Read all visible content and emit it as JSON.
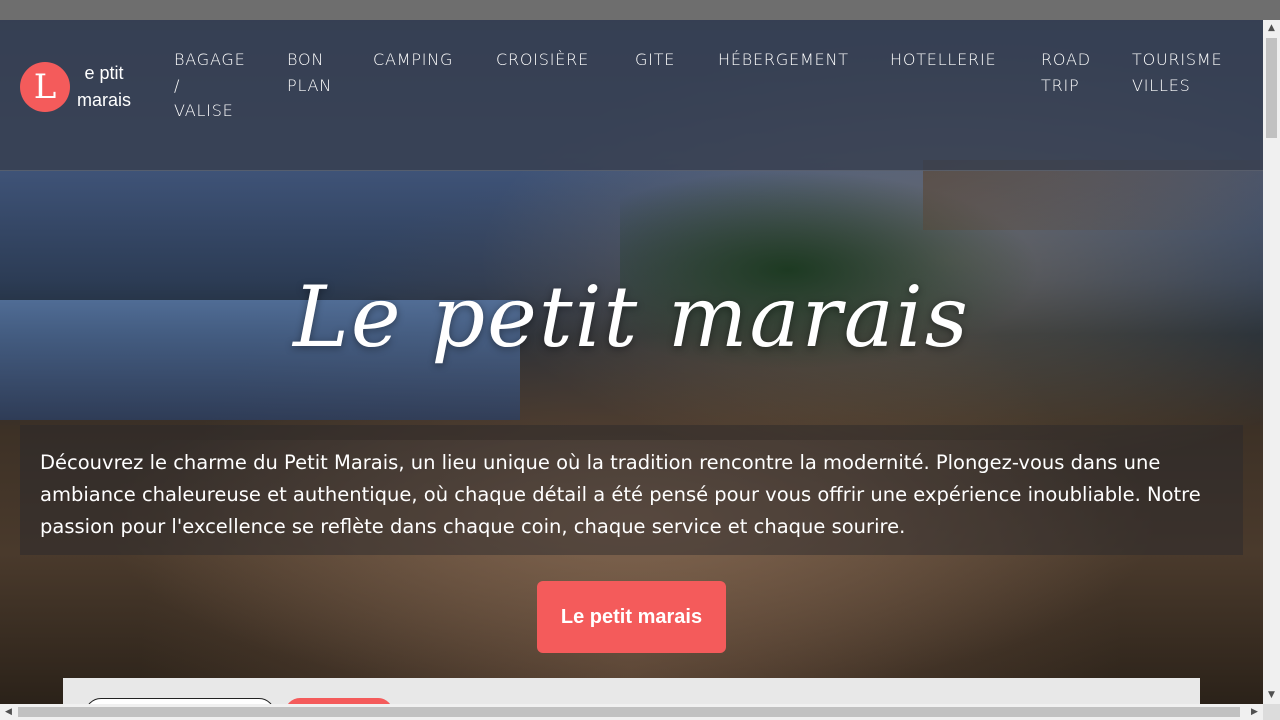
{
  "brand": {
    "logo_letter": "L",
    "name_line1": "e ptit",
    "name_line2": "marais",
    "accent_color": "#f45b5b"
  },
  "nav": {
    "items": [
      {
        "lines": [
          "BAGAGE",
          "/",
          "VALISE"
        ]
      },
      {
        "lines": [
          "BON",
          "PLAN"
        ]
      },
      {
        "lines": [
          "CAMPING"
        ]
      },
      {
        "lines": [
          "CROISIÈRE"
        ]
      },
      {
        "lines": [
          "GITE"
        ]
      },
      {
        "lines": [
          "HÉBERGEMENT"
        ]
      },
      {
        "lines": [
          "HOTELLERIE"
        ]
      },
      {
        "lines": [
          "ROAD",
          "TRIP"
        ]
      },
      {
        "lines": [
          "TOURISME",
          "VILLES"
        ]
      }
    ]
  },
  "hero": {
    "title": "Le petit marais",
    "intro": "Découvrez le charme du Petit Marais, un lieu unique où la tradition rencontre la modernité. Plongez-vous dans une ambiance chaleureuse et authentique, où chaque détail a été pensé pour vous offrir une expérience inoubliable. Notre passion pour l'excellence se reflète dans chaque coin, chaque service et chaque sourire.",
    "cta_label": "Le petit marais"
  },
  "scrollbars": {
    "up_arrow": "▲",
    "down_arrow": "▼",
    "left_arrow": "◀",
    "right_arrow": "▶"
  }
}
